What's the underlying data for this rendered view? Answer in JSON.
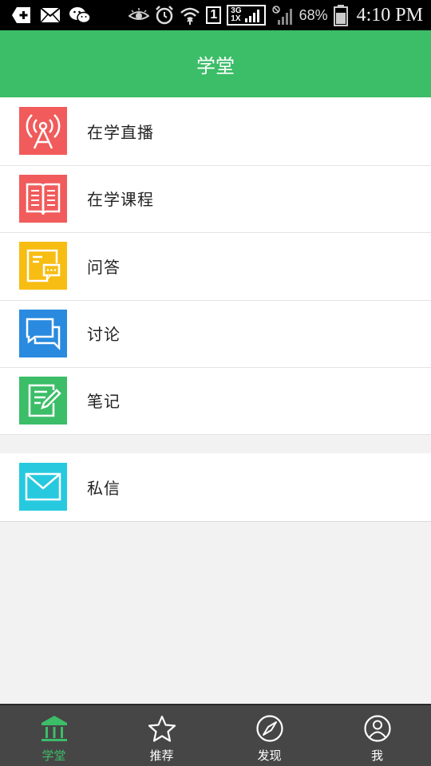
{
  "status_bar": {
    "left_icons": [
      "add-box-icon",
      "mail-icon",
      "wechat-icon"
    ],
    "right_icons": [
      "eye-icon",
      "alarm-icon",
      "wifi-icon",
      "sim-icon",
      "network-icon",
      "signal-icon",
      "battery-icon"
    ],
    "sim_label": "1",
    "network_top": "3G",
    "network_bottom": "1X",
    "battery_percent": "68%",
    "time": "4:10 PM"
  },
  "header": {
    "title": "学堂"
  },
  "colors": {
    "accent": "#3cbd68",
    "live": "#f15b5b",
    "course": "#f15b5b",
    "qa": "#f7bd12",
    "discussion": "#2a8ae0",
    "notes": "#3cbd68",
    "message": "#27c9df",
    "tabbar": "#464646"
  },
  "menu": {
    "main": [
      {
        "label": "在学直播",
        "icon": "broadcast-tower-icon"
      },
      {
        "label": "在学课程",
        "icon": "open-book-icon"
      },
      {
        "label": "问答",
        "icon": "qa-document-icon"
      },
      {
        "label": "讨论",
        "icon": "chat-bubbles-icon"
      },
      {
        "label": "笔记",
        "icon": "note-pencil-icon"
      }
    ],
    "secondary": [
      {
        "label": "私信",
        "icon": "envelope-icon"
      }
    ]
  },
  "tabs": [
    {
      "label": "学堂",
      "icon": "classroom-icon",
      "active": true
    },
    {
      "label": "推荐",
      "icon": "star-icon",
      "active": false
    },
    {
      "label": "发现",
      "icon": "compass-icon",
      "active": false
    },
    {
      "label": "我",
      "icon": "user-icon",
      "active": false
    }
  ]
}
